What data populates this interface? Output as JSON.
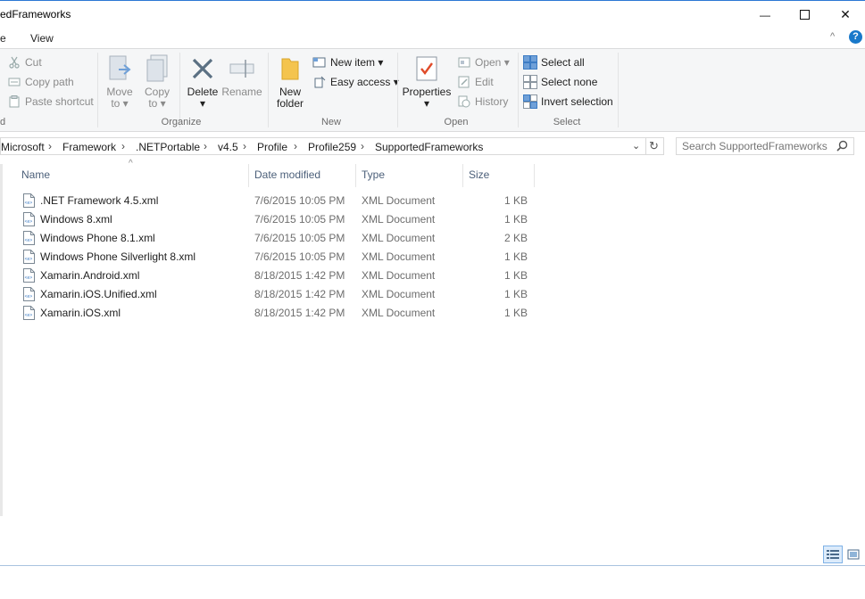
{
  "window": {
    "title": "edFrameworks",
    "min_glyph": "—",
    "max_glyph": "☐",
    "close_glyph": "✕"
  },
  "tabs": {
    "file": "e",
    "view": "View"
  },
  "ribbon": {
    "clipboard": {
      "cut": "Cut",
      "copy_path": "Copy path",
      "paste_shortcut": "Paste shortcut"
    },
    "organize": {
      "label": "Organize",
      "move_to": [
        "Move",
        "to"
      ],
      "copy_to": [
        "Copy",
        "to"
      ],
      "delete": "Delete",
      "rename": "Rename"
    },
    "new": {
      "label": "New",
      "new_folder": [
        "New",
        "folder"
      ],
      "new_item": "New item",
      "easy_access": "Easy access"
    },
    "open": {
      "label": "Open",
      "properties": "Properties",
      "open": "Open",
      "edit": "Edit",
      "history": "History"
    },
    "select": {
      "label": "Select",
      "select_all": "Select all",
      "select_none": "Select none",
      "invert": "Invert selection"
    },
    "clipboard_label": "d"
  },
  "address": {
    "crumbs": [
      "Microsoft",
      "Framework",
      ".NETPortable",
      "v4.5",
      "Profile",
      "Profile259",
      "SupportedFrameworks"
    ]
  },
  "search": {
    "placeholder": "Search SupportedFrameworks"
  },
  "columns": {
    "name": "Name",
    "date": "Date modified",
    "type": "Type",
    "size": "Size"
  },
  "files": [
    {
      "name": ".NET Framework 4.5.xml",
      "date": "7/6/2015 10:05 PM",
      "type": "XML Document",
      "size": "1 KB"
    },
    {
      "name": "Windows 8.xml",
      "date": "7/6/2015 10:05 PM",
      "type": "XML Document",
      "size": "1 KB"
    },
    {
      "name": "Windows Phone 8.1.xml",
      "date": "7/6/2015 10:05 PM",
      "type": "XML Document",
      "size": "2 KB"
    },
    {
      "name": "Windows Phone Silverlight 8.xml",
      "date": "7/6/2015 10:05 PM",
      "type": "XML Document",
      "size": "1 KB"
    },
    {
      "name": "Xamarin.Android.xml",
      "date": "8/18/2015 1:42 PM",
      "type": "XML Document",
      "size": "1 KB"
    },
    {
      "name": "Xamarin.iOS.Unified.xml",
      "date": "8/18/2015 1:42 PM",
      "type": "XML Document",
      "size": "1 KB"
    },
    {
      "name": "Xamarin.iOS.xml",
      "date": "8/18/2015 1:42 PM",
      "type": "XML Document",
      "size": "1 KB"
    }
  ],
  "colors": {
    "accent": "#2b78d4",
    "help": "#1979ca",
    "header_text": "#4c607a",
    "muted_text": "#6d6d6d"
  }
}
